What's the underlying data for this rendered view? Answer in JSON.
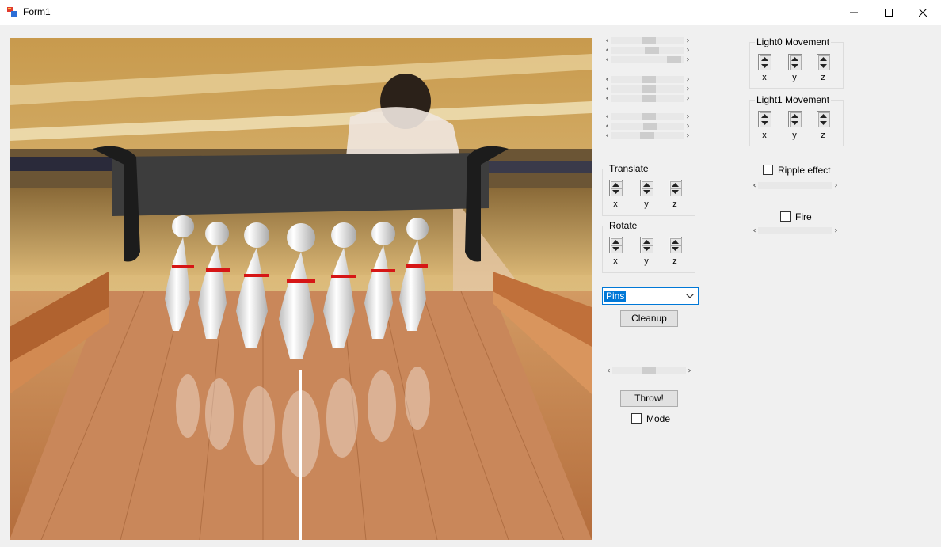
{
  "window": {
    "title": "Form1"
  },
  "panel": {
    "translate_label": "Translate",
    "rotate_label": "Rotate",
    "axes": [
      "x",
      "y",
      "z"
    ],
    "pins_select_value": "Pins",
    "cleanup_label": "Cleanup",
    "throw_label": "Throw!",
    "mode_label": "Mode"
  },
  "lights": {
    "light0_label": "Light0 Movement",
    "light1_label": "Light1 Movement",
    "ripple_label": "Ripple effect",
    "fire_label": "Fire"
  },
  "icons": {
    "app": "form-app-icon",
    "minimize": "minimize-icon",
    "maximize": "maximize-icon",
    "close": "close-icon"
  }
}
